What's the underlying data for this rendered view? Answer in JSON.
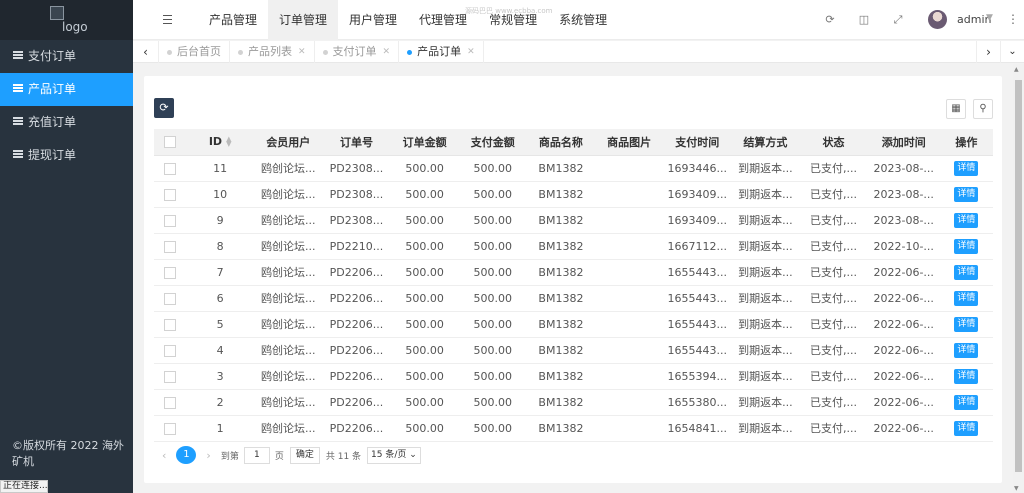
{
  "sidebar": {
    "logo_alt": "logo",
    "items": [
      {
        "label": "支付订单",
        "active": false
      },
      {
        "label": "产品订单",
        "active": true
      },
      {
        "label": "充值订单",
        "active": false
      },
      {
        "label": "提现订单",
        "active": false
      }
    ],
    "copyright": "©版权所有 2022 海外矿机"
  },
  "status_bar": "正在连接...",
  "header": {
    "nav": [
      {
        "label": "产品管理",
        "active": false
      },
      {
        "label": "订单管理",
        "active": true
      },
      {
        "label": "用户管理",
        "active": false
      },
      {
        "label": "代理管理",
        "active": false
      },
      {
        "label": "常规管理",
        "active": false
      },
      {
        "label": "系统管理",
        "active": false
      }
    ],
    "watermark": "源码巴巴 www.ecbba.com",
    "user": "admin",
    "icons": [
      "refresh-icon",
      "trash-icon",
      "fullscreen-icon"
    ]
  },
  "tabs": {
    "items": [
      {
        "label": "后台首页",
        "closable": false,
        "active": false
      },
      {
        "label": "产品列表",
        "closable": true,
        "active": false
      },
      {
        "label": "支付订单",
        "closable": true,
        "active": false
      },
      {
        "label": "产品订单",
        "closable": true,
        "active": true
      }
    ]
  },
  "table": {
    "columns": [
      "ID",
      "会员用户",
      "订单号",
      "订单金额",
      "支付金额",
      "商品名称",
      "商品图片",
      "支付时间",
      "结算方式",
      "状态",
      "添加时间",
      "操作"
    ],
    "action_label": "详情",
    "rows": [
      {
        "id": "11",
        "user": "鸥创论坛...",
        "order_no": "PD2308...",
        "amount": "500.00",
        "paid": "500.00",
        "product": "BM1382",
        "image": "",
        "pay_time": "1693446...",
        "settle": "到期返本...",
        "status": "已支付,...",
        "added": "2023-08-..."
      },
      {
        "id": "10",
        "user": "鸥创论坛...",
        "order_no": "PD2308...",
        "amount": "500.00",
        "paid": "500.00",
        "product": "BM1382",
        "image": "",
        "pay_time": "1693409...",
        "settle": "到期返本...",
        "status": "已支付,...",
        "added": "2023-08-..."
      },
      {
        "id": "9",
        "user": "鸥创论坛...",
        "order_no": "PD2308...",
        "amount": "500.00",
        "paid": "500.00",
        "product": "BM1382",
        "image": "",
        "pay_time": "1693409...",
        "settle": "到期返本...",
        "status": "已支付,...",
        "added": "2023-08-..."
      },
      {
        "id": "8",
        "user": "鸥创论坛...",
        "order_no": "PD2210...",
        "amount": "500.00",
        "paid": "500.00",
        "product": "BM1382",
        "image": "",
        "pay_time": "1667112...",
        "settle": "到期返本...",
        "status": "已支付,...",
        "added": "2022-10-..."
      },
      {
        "id": "7",
        "user": "鸥创论坛...",
        "order_no": "PD2206...",
        "amount": "500.00",
        "paid": "500.00",
        "product": "BM1382",
        "image": "",
        "pay_time": "1655443...",
        "settle": "到期返本...",
        "status": "已支付,...",
        "added": "2022-06-..."
      },
      {
        "id": "6",
        "user": "鸥创论坛...",
        "order_no": "PD2206...",
        "amount": "500.00",
        "paid": "500.00",
        "product": "BM1382",
        "image": "",
        "pay_time": "1655443...",
        "settle": "到期返本...",
        "status": "已支付,...",
        "added": "2022-06-..."
      },
      {
        "id": "5",
        "user": "鸥创论坛...",
        "order_no": "PD2206...",
        "amount": "500.00",
        "paid": "500.00",
        "product": "BM1382",
        "image": "",
        "pay_time": "1655443...",
        "settle": "到期返本...",
        "status": "已支付,...",
        "added": "2022-06-..."
      },
      {
        "id": "4",
        "user": "鸥创论坛...",
        "order_no": "PD2206...",
        "amount": "500.00",
        "paid": "500.00",
        "product": "BM1382",
        "image": "",
        "pay_time": "1655443...",
        "settle": "到期返本...",
        "status": "已支付,...",
        "added": "2022-06-..."
      },
      {
        "id": "3",
        "user": "鸥创论坛...",
        "order_no": "PD2206...",
        "amount": "500.00",
        "paid": "500.00",
        "product": "BM1382",
        "image": "",
        "pay_time": "1655394...",
        "settle": "到期返本...",
        "status": "已支付,...",
        "added": "2022-06-..."
      },
      {
        "id": "2",
        "user": "鸥创论坛...",
        "order_no": "PD2206...",
        "amount": "500.00",
        "paid": "500.00",
        "product": "BM1382",
        "image": "",
        "pay_time": "1655380...",
        "settle": "到期返本...",
        "status": "已支付,...",
        "added": "2022-06-..."
      },
      {
        "id": "1",
        "user": "鸥创论坛...",
        "order_no": "PD2206...",
        "amount": "500.00",
        "paid": "500.00",
        "product": "BM1382",
        "image": "",
        "pay_time": "1654841...",
        "settle": "到期返本...",
        "status": "已支付,...",
        "added": "2022-06-..."
      }
    ]
  },
  "pager": {
    "current": "1",
    "goto_label": "到第",
    "page_input": "1",
    "page_unit": "页",
    "confirm": "确定",
    "total": "共 11 条",
    "per_page": "15 条/页"
  },
  "colors": {
    "primary": "#1e9fff",
    "sidebar_bg": "#28333e",
    "refresh_btn": "#2f4056"
  }
}
